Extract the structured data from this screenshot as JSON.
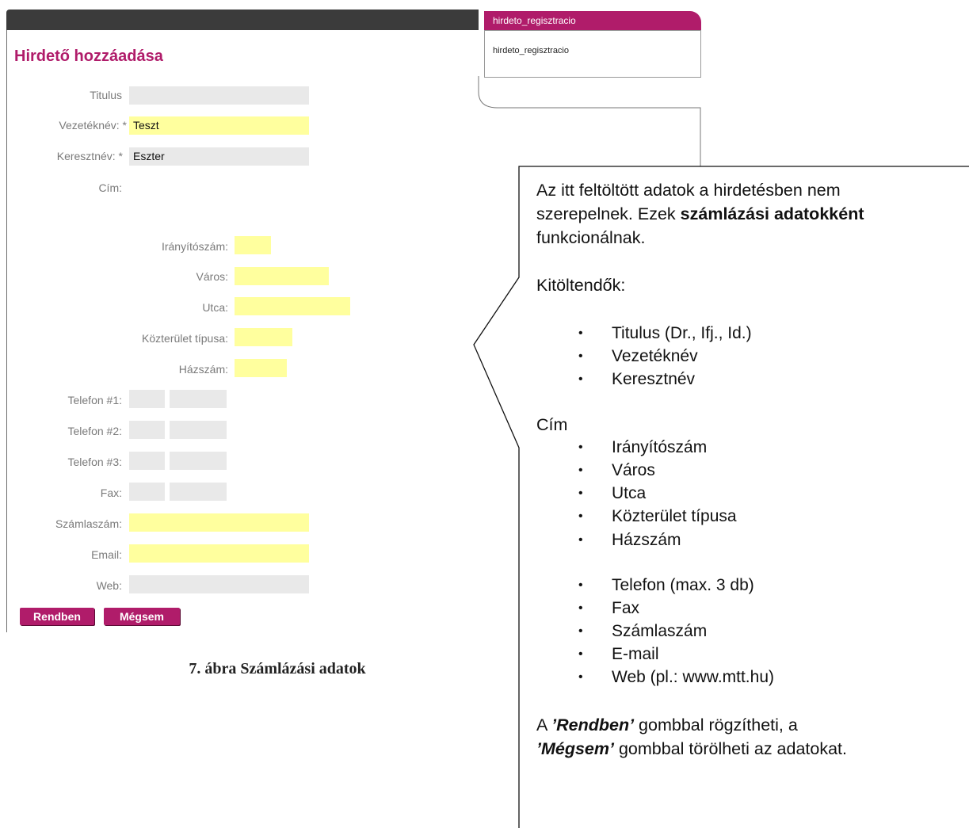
{
  "side_box": {
    "title": "hirdeto_regisztracio",
    "text": "hirdeto_regisztracio"
  },
  "form": {
    "title": "Hirdető hozzáadása",
    "titulus_label": "Titulus",
    "vezeteknev_label": "Vezetéknév: *",
    "vezeteknev_value": "Teszt",
    "keresztnev_label": "Keresztnév: *",
    "keresztnev_value": "Eszter",
    "cim_label": "Cím:",
    "iranyitoszam_label": "Irányítószám:",
    "varos_label": "Város:",
    "utca_label": "Utca:",
    "kozterulet_label": "Közterület típusa:",
    "hazszam_label": "Házszám:",
    "telefon1_label": "Telefon #1:",
    "telefon2_label": "Telefon #2:",
    "telefon3_label": "Telefon #3:",
    "fax_label": "Fax:",
    "szamlaszam_label": "Számlaszám:",
    "email_label": "Email:",
    "web_label": "Web:",
    "ok_button": "Rendben",
    "cancel_button": "Mégsem"
  },
  "caption": "7. ábra Számlázási adatok",
  "callout": {
    "intro_line1": "Az itt feltöltött adatok a hirdetésben nem",
    "intro_line2a": "szerepelnek. Ezek ",
    "intro_line2b": "számlázási adatokként",
    "intro_line3": "funkcionálnak.",
    "required_heading": "Kitöltendők:",
    "name_items": [
      "Titulus (Dr., Ifj., Id.)",
      "Vezetéknév",
      "Keresztnév"
    ],
    "address_heading": "Cím",
    "address_items": [
      "Irányítószám",
      "Város",
      "Utca",
      "Közterület típusa",
      "Házszám"
    ],
    "contact_items": [
      "Telefon (max. 3 db)",
      "Fax",
      "Számlaszám",
      "E-mail",
      "Web (pl.: www.mtt.hu)"
    ],
    "footer_a": "A ",
    "footer_ok": "’Rendben’",
    "footer_b": " gombbal rögzítheti, a",
    "footer_cancel": "’Mégsem’",
    "footer_c": " gombbal törölheti az adatokat."
  }
}
